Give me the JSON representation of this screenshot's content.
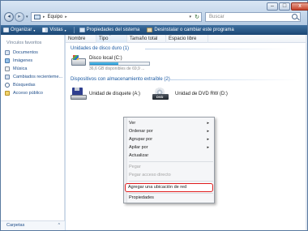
{
  "window": {
    "controls": {
      "minimize": "–",
      "maximize": "□",
      "close": "x"
    }
  },
  "address": {
    "back_icon": "arrow-left-icon",
    "forward_icon": "arrow-right-icon",
    "dropdown_glyph": "▾",
    "separator": "▸",
    "crumb": "Equipo",
    "refresh_glyph": "↻",
    "search_placeholder": "Buscar"
  },
  "toolbar": {
    "organize": "Organizar",
    "views": "Vistas",
    "system_properties": "Propiedades del sistema",
    "uninstall": "Desinstalar o cambiar este programa",
    "dropdown_glyph": "▾"
  },
  "nav": {
    "heading": "Vínculos favoritos",
    "items": [
      {
        "label": "Documentos",
        "icon": "documents-icon"
      },
      {
        "label": "Imágenes",
        "icon": "pictures-icon"
      },
      {
        "label": "Música",
        "icon": "music-icon"
      },
      {
        "label": "Cambiados recienteme...",
        "icon": "recent-icon"
      },
      {
        "label": "Búsquedas",
        "icon": "searches-icon"
      },
      {
        "label": "Acceso público",
        "icon": "public-folder-icon"
      }
    ],
    "folders": "Carpetas",
    "folders_chevron": "^"
  },
  "columns": [
    "Nombre",
    "Tipo",
    "Tamaño total",
    "Espacio libre"
  ],
  "groups": {
    "hard_drives": "Unidades de disco duro (1)",
    "removable": "Dispositivos con almacenamiento extraíble (2)"
  },
  "local_disk": {
    "name": "Disco local (C:)",
    "free_text": "36,6 GB disponibles de 69,9 ...",
    "used_fraction": 0.48
  },
  "devices": {
    "floppy": "Unidad de disquete (A:)",
    "dvd": "Unidad de DVD RW (D:)",
    "dvd_badge": "DVD"
  },
  "context_menu": {
    "view": "Ver",
    "sort_by": "Ordenar por",
    "group_by": "Agrupar por",
    "stack_by": "Apilar por",
    "refresh": "Actualizar",
    "paste": "Pegar",
    "paste_shortcut": "Pegar acceso directo",
    "add_network_location": "Agregar una ubicación de red",
    "properties": "Propiedades",
    "submenu_arrow": "▸"
  },
  "colors": {
    "toolbar": "#1b4673",
    "link": "#1f4e8a",
    "group_header": "#1b5aa3",
    "highlight_border": "#e01b1b"
  }
}
